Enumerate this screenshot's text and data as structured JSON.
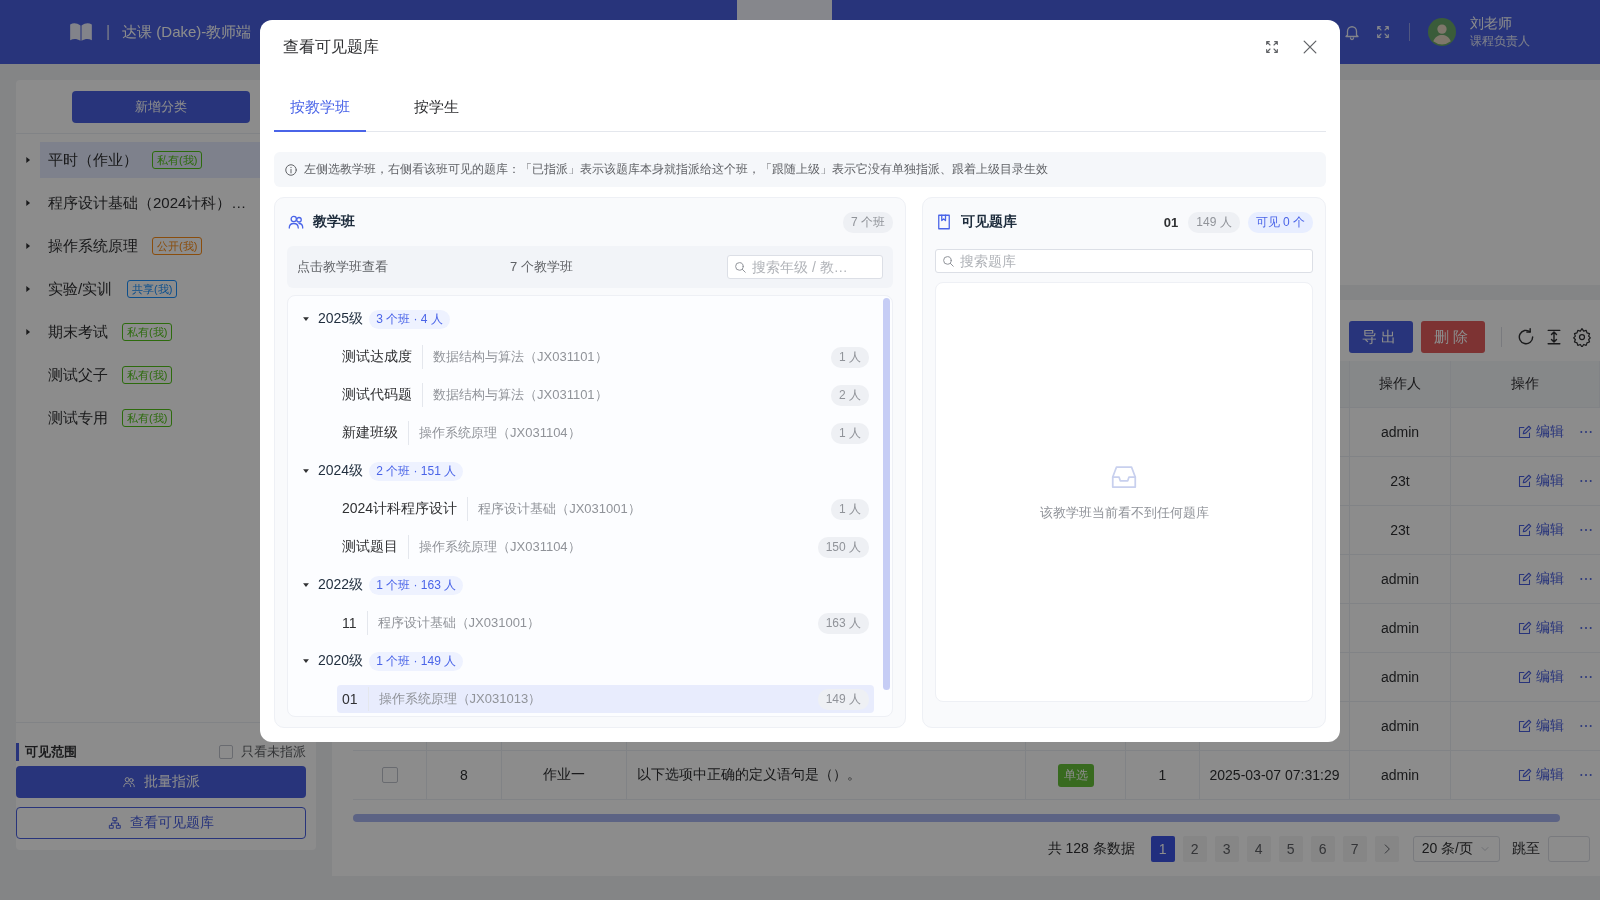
{
  "header": {
    "brand": "达课 (Dake)-教师端",
    "separator": "|",
    "user": {
      "name": "刘老师",
      "role": "课程负责人"
    }
  },
  "sidebar": {
    "add_button": "新增分类",
    "items": [
      {
        "label": "平时（作业）",
        "kind": "folder",
        "expanded": false,
        "selected": true,
        "tag": {
          "text": "私有(我)",
          "color": "#2d6c0e"
        }
      },
      {
        "label": "程序设计基础（2024计科）…",
        "kind": "folder",
        "expanded": false,
        "selected": false
      },
      {
        "label": "操作系统原理",
        "kind": "folder",
        "expanded": false,
        "selected": false,
        "tag": {
          "text": "公开(我)",
          "color": "#8a4d0c"
        }
      },
      {
        "label": "实验/实训",
        "kind": "folder",
        "expanded": false,
        "selected": false,
        "tag": {
          "text": "共享(我)",
          "color": "#0d4f8c"
        }
      },
      {
        "label": "期末考试",
        "kind": "folder",
        "expanded": false,
        "selected": false,
        "tag": {
          "text": "私有(我)",
          "color": "#2d6c0e"
        }
      },
      {
        "label": "测试父子",
        "kind": "leaf",
        "selected": false,
        "tag": {
          "text": "私有(我)",
          "color": "#2d6c0e"
        }
      },
      {
        "label": "测试专用",
        "kind": "leaf",
        "selected": false,
        "tag": {
          "text": "私有(我)",
          "color": "#2d6c0e"
        }
      }
    ],
    "footer": {
      "title": "可见范围",
      "filter": {
        "label": "只看未指派",
        "checked": false
      },
      "buttons": [
        {
          "label": "批量指派",
          "kind": "primary"
        },
        {
          "label": "查看可见题库",
          "kind": "outline"
        }
      ]
    }
  },
  "toolbar": {
    "buttons": [
      {
        "label": "导出",
        "kind": "primary"
      },
      {
        "label": "删除",
        "kind": "danger"
      }
    ]
  },
  "table": {
    "columns": {
      "operator": "操作人",
      "actions": "操作"
    },
    "rows": [
      {
        "operator": "admin",
        "edit": "编辑"
      },
      {
        "operator": "23t",
        "edit": "编辑"
      },
      {
        "operator": "23t",
        "edit": "编辑"
      },
      {
        "operator": "admin",
        "edit": "编辑"
      },
      {
        "operator": "admin",
        "edit": "编辑"
      },
      {
        "operator": "admin",
        "edit": "编辑"
      },
      {
        "operator": "admin",
        "edit": "编辑"
      },
      {
        "checked": false,
        "no": "8",
        "type": "作业一",
        "question": "以下选项中正确的定义语句是（）。",
        "tag": "单选",
        "score": "1",
        "time": "2025-03-07 07:31:29",
        "operator": "admin",
        "edit": "编辑"
      }
    ]
  },
  "pagination": {
    "total": "共 128 条数据",
    "pages": [
      {
        "label": "1",
        "selected": true
      },
      {
        "label": "2",
        "selected": false
      },
      {
        "label": "3",
        "selected": false
      },
      {
        "label": "4",
        "selected": false
      },
      {
        "label": "5",
        "selected": false
      },
      {
        "label": "6",
        "selected": false
      },
      {
        "label": "7",
        "selected": false
      }
    ],
    "page_size": "20 条/页",
    "jump_label": "跳至"
  },
  "modal": {
    "title": "查看可见题库",
    "tabs": [
      {
        "label": "按教学班",
        "selected": true
      },
      {
        "label": "按学生",
        "selected": false
      }
    ],
    "notice": "左侧选教学班，右侧看该班可见的题库：「已指派」表示该题库本身就指派给这个班，「跟随上级」表示它没有单独指派、跟着上级目录生效",
    "classes_panel": {
      "title": "教学班",
      "count": "7 个班",
      "hint": "点击教学班查看",
      "summary": "7 个教学班",
      "search": {
        "placeholder": "搜索年级 / 教…"
      },
      "grades": [
        {
          "name": "2025级",
          "badge": "3 个班 · 4 人",
          "expanded": true,
          "classes": [
            {
              "name": "测试达成度",
              "course": "数据结构与算法（JX031101）",
              "count": "1 人",
              "selected": false
            },
            {
              "name": "测试代码题",
              "course": "数据结构与算法（JX031101）",
              "count": "2 人",
              "selected": false
            },
            {
              "name": "新建班级",
              "course": "操作系统原理（JX031104）",
              "count": "1 人",
              "selected": false
            }
          ]
        },
        {
          "name": "2024级",
          "badge": "2 个班 · 151 人",
          "expanded": true,
          "classes": [
            {
              "name": "2024计科程序设计",
              "course": "程序设计基础（JX031001）",
              "count": "1 人",
              "selected": false
            },
            {
              "name": "测试题目",
              "course": "操作系统原理（JX031104）",
              "count": "150 人",
              "selected": false
            }
          ]
        },
        {
          "name": "2022级",
          "badge": "1 个班 · 163 人",
          "expanded": true,
          "classes": [
            {
              "name": "11",
              "course": "程序设计基础（JX031001）",
              "count": "163 人",
              "selected": false
            }
          ]
        },
        {
          "name": "2020级",
          "badge": "1 个班 · 149 人",
          "expanded": true,
          "classes": [
            {
              "name": "01",
              "course": "操作系统原理（JX031013）",
              "count": "149 人",
              "selected": true
            }
          ]
        }
      ]
    },
    "library_panel": {
      "title": "可见题库",
      "class_name": "01",
      "people": "149 人",
      "visible": "可见 0 个",
      "search": {
        "placeholder": "搜索题库"
      },
      "empty_text": "该教学班当前看不到任何题库"
    }
  }
}
